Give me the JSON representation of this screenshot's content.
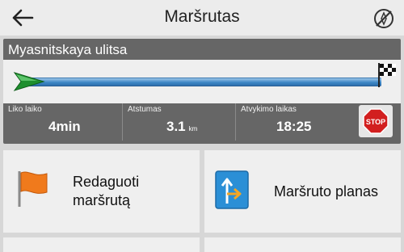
{
  "header": {
    "title": "Maršrutas",
    "back_icon": "arrow-left-icon",
    "no_route_icon": "compass-crossed-icon"
  },
  "route": {
    "street": "Myasnitskaya ulitsa",
    "progress": 0.0,
    "stats": [
      {
        "label": "Liko laiko",
        "value": "4min",
        "unit": ""
      },
      {
        "label": "Atstumas",
        "value": "3.1",
        "unit": "km"
      },
      {
        "label": "Atvykimo laikas",
        "value": "18:25",
        "unit": ""
      }
    ],
    "stop_label": "STOP"
  },
  "menu": {
    "edit_route": {
      "line1": "Redaguoti",
      "line2": "maršrutą",
      "icon": "orange-flag-icon"
    },
    "route_plan": {
      "label": "Maršruto planas",
      "icon": "turn-arrows-icon"
    }
  },
  "colors": {
    "route_bar": "#3d87c6",
    "start_arrow": "#1e8f2e",
    "stop_sign": "#d21f1f",
    "flag": "#f07a1c"
  }
}
